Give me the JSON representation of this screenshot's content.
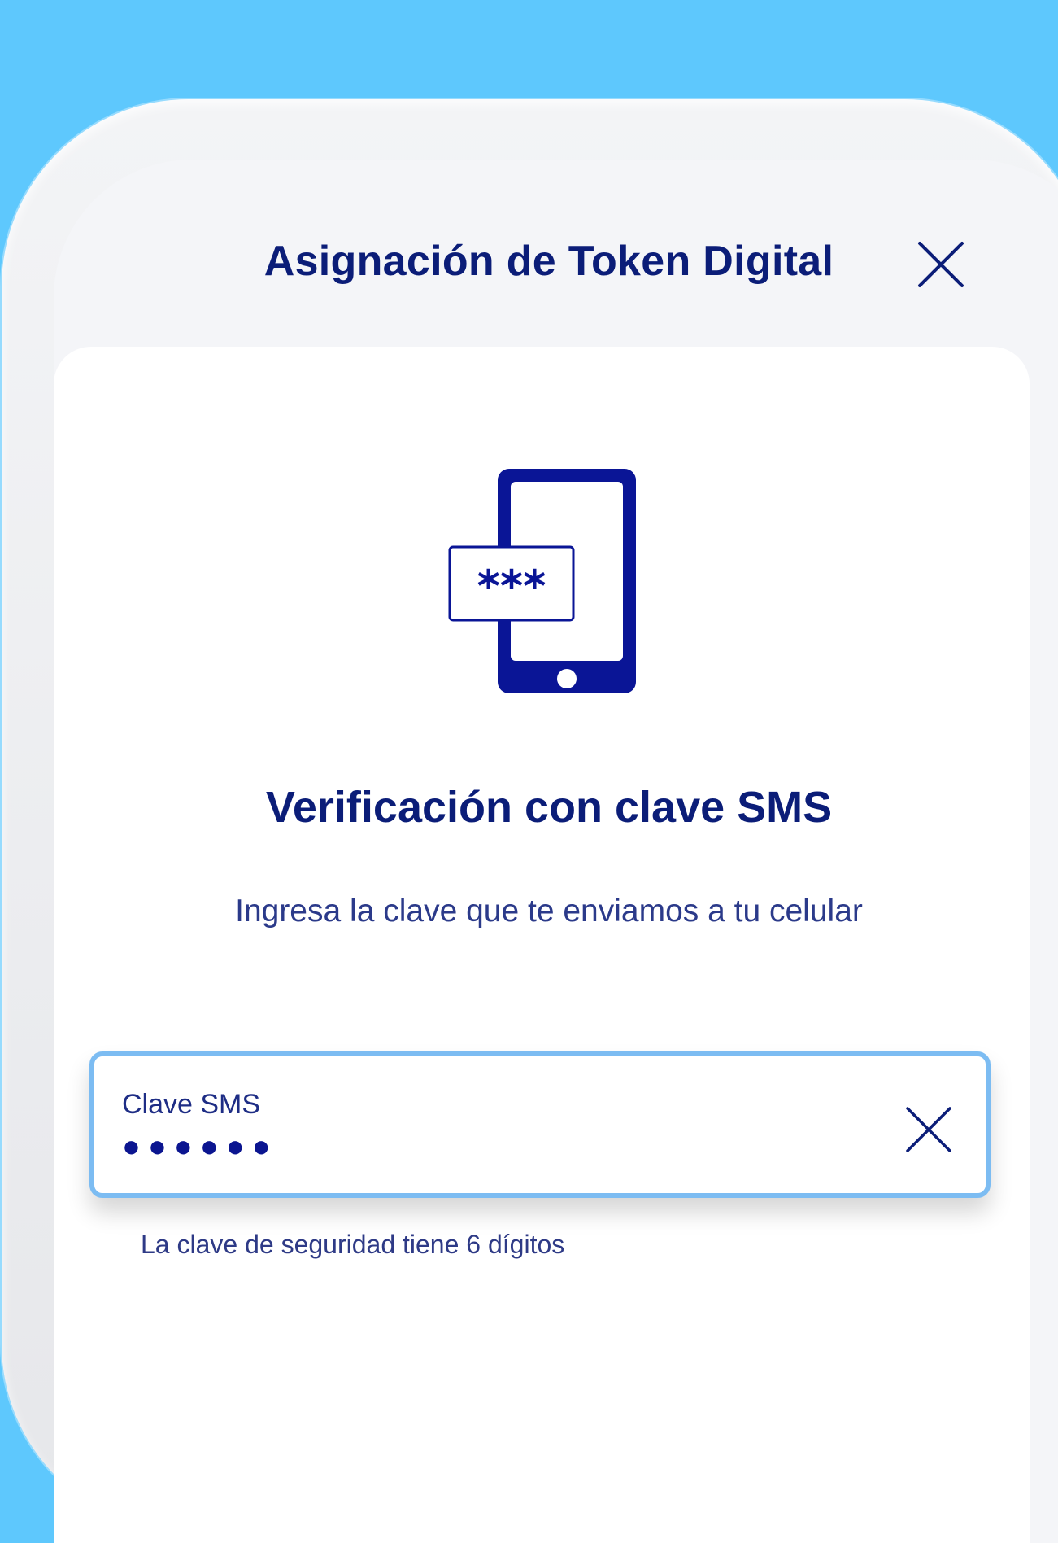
{
  "header": {
    "title": "Asignación de Token Digital",
    "close_icon": "close-icon"
  },
  "illustration": {
    "icon": "phone-sms-code-icon",
    "code_text": "***"
  },
  "content": {
    "subtitle": "Verificación con clave SMS",
    "description": "Ingresa la clave que te enviamos a tu celular"
  },
  "sms_field": {
    "label": "Clave SMS",
    "value": "●●●●●●",
    "clear_icon": "clear-icon",
    "helper": "La clave de seguridad tiene 6 dígitos"
  },
  "colors": {
    "background": "#5ec8fd",
    "brand_navy": "#0b1d78",
    "field_border": "#7cbcf2",
    "screen": "#f4f5f8"
  }
}
